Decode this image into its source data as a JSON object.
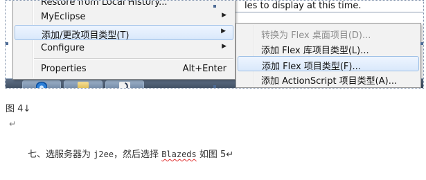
{
  "background_window": {
    "partial_message": "les to display at this time."
  },
  "main_menu": {
    "items": [
      {
        "label": "Restore from Local History...",
        "has_submenu": false,
        "shortcut": ""
      },
      {
        "label": "MyEclipse",
        "has_submenu": true,
        "shortcut": ""
      },
      {
        "label": "添加/更改项目类型(T)",
        "has_submenu": true,
        "shortcut": ""
      },
      {
        "label": "Configure",
        "has_submenu": true,
        "shortcut": ""
      },
      {
        "label": "Properties",
        "has_submenu": false,
        "shortcut": "Alt+Enter"
      }
    ],
    "arrow_glyph": "▶",
    "highlighted_index": 2
  },
  "sub_menu": {
    "items": [
      {
        "label": "转换为 Flex 桌面项目(D)...",
        "enabled": false
      },
      {
        "label": "添加 Flex 库项目类型(L)...",
        "enabled": true
      },
      {
        "label": "添加 Flex 项目类型(F)...",
        "enabled": true
      },
      {
        "label": "添加 ActionScript 项目类型(A)...",
        "enabled": true
      }
    ],
    "highlighted_index": 2
  },
  "taskbar": {
    "buttons": [
      {
        "name": "internet-explorer-icon"
      },
      {
        "name": "folder-icon"
      },
      {
        "name": "app-icon"
      }
    ]
  },
  "document": {
    "caption": "图 4↓",
    "return_mark": "↵",
    "paragraph_prefix": "七、选服务器为 ",
    "paragraph_code1": "j2ee",
    "paragraph_middle": "，然后选择 ",
    "paragraph_code2": "Blazeds",
    "paragraph_suffix": " 如图 5↵"
  },
  "colors": {
    "menu_background": "#f2f2f2",
    "menu_highlight": "#d9e8fb",
    "taskbar": "#4a5a70"
  }
}
